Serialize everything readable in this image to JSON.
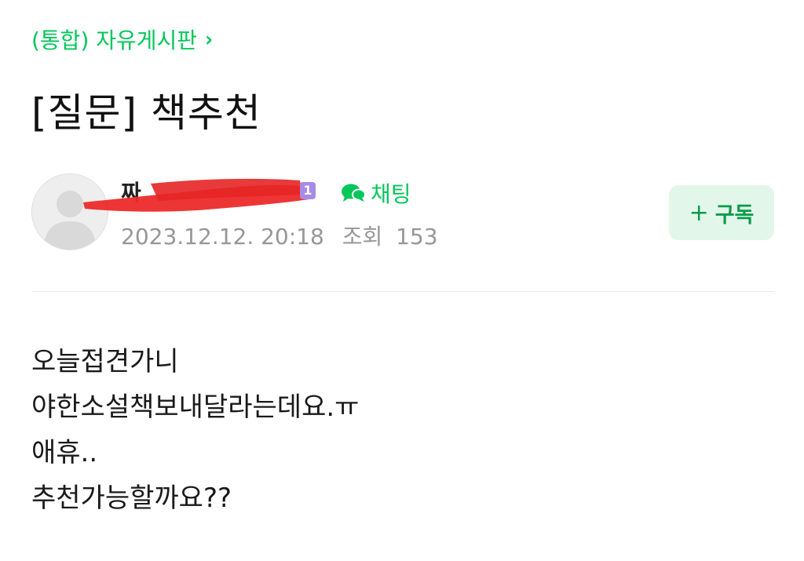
{
  "board": {
    "link_label": "(통합) 자유게시판",
    "chevron_icon": "chevron-right-icon",
    "color": "#03c75a"
  },
  "post": {
    "title": "[질문] 책추천",
    "author": {
      "name": "짜",
      "level_badge": "1",
      "redacted": true,
      "avatar_icon": "default-avatar-icon"
    },
    "chat_label": "채팅",
    "chat_icon": "chat-bubble-icon",
    "date": "2023.12.12. 20:18",
    "views_label": "조회",
    "views": "153",
    "subscribe": {
      "icon": "plus-icon",
      "label": "구독",
      "bg_color": "#e2f7ea",
      "text_color": "#0a9b4a"
    },
    "content_lines": [
      "오늘접견가니",
      "야한소설책보내달라는데요.ㅠ",
      "애휴..",
      "추천가능할까요??"
    ]
  }
}
